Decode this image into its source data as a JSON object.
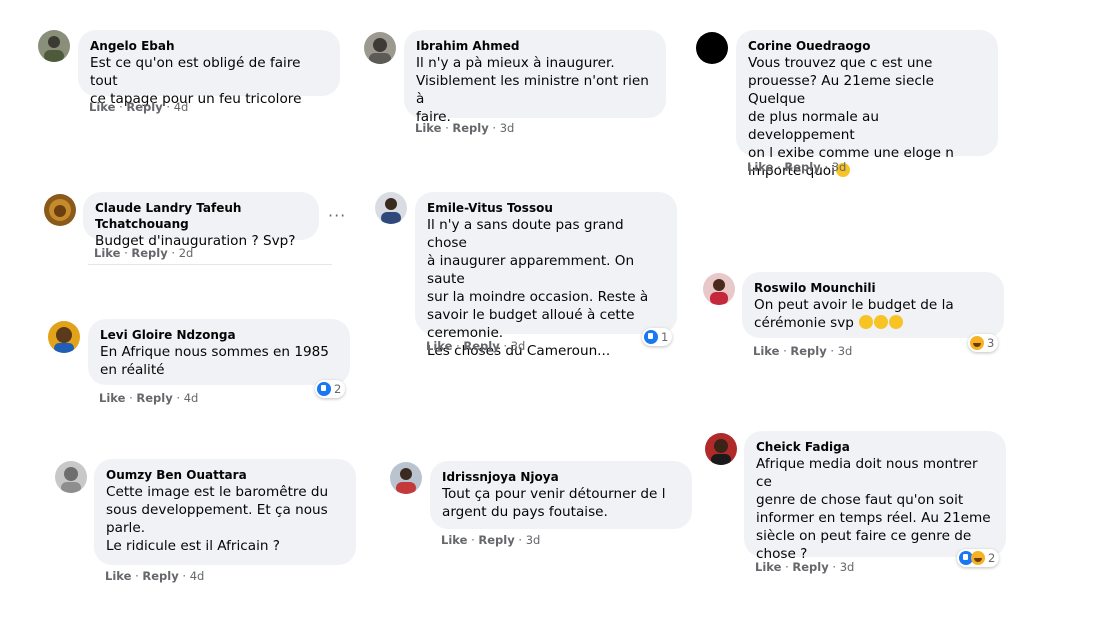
{
  "common": {
    "like": "Like",
    "reply": "Reply",
    "sep": " · "
  },
  "comments": [
    {
      "name": "Angelo Ebah",
      "text": "Est ce qu'on est obligé de faire tout\nce tapage pour un feu tricolore",
      "time": "4d"
    },
    {
      "name": "Ibrahim Ahmed",
      "text": "Il n'y a pà mieux à inaugurer.\nVisiblement les ministre n'ont rien à\nfaire.",
      "time": "3d"
    },
    {
      "name": "Corine Ouedraogo",
      "text": "Vous trouvez que c est une\nprouesse? Au 21eme siecle Quelque\nde plus normale au developpement\non l exibe comme une eloge n\nimporte quoi",
      "time": "3d"
    },
    {
      "name": "Claude Landry Tafeuh Tchatchouang",
      "text": "Budget d'inauguration ? Svp?",
      "time": "2d"
    },
    {
      "name": "Emile-Vitus Tossou",
      "text": "Il n'y a sans doute pas grand chose\nà inaugurer apparemment. On saute\nsur la moindre occasion. Reste à\nsavoir le budget alloué à cette\nceremonie.\nLes choses du Cameroun...",
      "time": "3d",
      "reactions": "1"
    },
    {
      "name": "Roswilo Mounchili",
      "text": "On peut avoir le budget de la\ncérémonie svp ",
      "time": "3d",
      "reactions": "3"
    },
    {
      "name": "Levi Gloire Ndzonga",
      "text": "En Afrique nous sommes en 1985\nen réalité",
      "time": "4d",
      "reactions": "2"
    },
    {
      "name": "Oumzy Ben Ouattara",
      "text": "Cette image est le baromêtre du\nsous developpement. Et ça nous\nparle.\nLe ridicule est il Africain ?",
      "time": "4d"
    },
    {
      "name": "Idrissnjoya Njoya",
      "text": "Tout ça pour venir détourner de l\nargent du pays foutaise.",
      "time": "3d"
    },
    {
      "name": "Cheick Fadiga",
      "text": "Afrique media doit nous montrer ce\ngenre de chose faut qu'on soit\ninformer en temps réel. Au 21eme\nsiècle on peut faire ce genre de\nchose ?",
      "time": "3d",
      "reactions": "2"
    }
  ],
  "more_label": "···"
}
